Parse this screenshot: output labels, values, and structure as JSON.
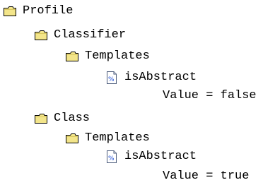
{
  "tree": {
    "root": {
      "label": "Profile",
      "icon": "folder-icon",
      "children": [
        {
          "label": "Classifier",
          "icon": "folder-icon",
          "children": [
            {
              "label": "Templates",
              "icon": "folder-icon",
              "children": [
                {
                  "label": "isAbstract",
                  "icon": "property-icon",
                  "value_text": "Value = false"
                }
              ]
            }
          ]
        },
        {
          "label": "Class",
          "icon": "folder-icon",
          "children": [
            {
              "label": "Templates",
              "icon": "folder-icon",
              "children": [
                {
                  "label": "isAbstract",
                  "icon": "property-icon",
                  "value_text": "Value = true"
                }
              ]
            }
          ]
        }
      ]
    }
  },
  "colors": {
    "folder_fill": "#f3e58a",
    "folder_outline": "#000000",
    "property_fill": "#ffffff",
    "property_accent": "#1f4fd6"
  }
}
